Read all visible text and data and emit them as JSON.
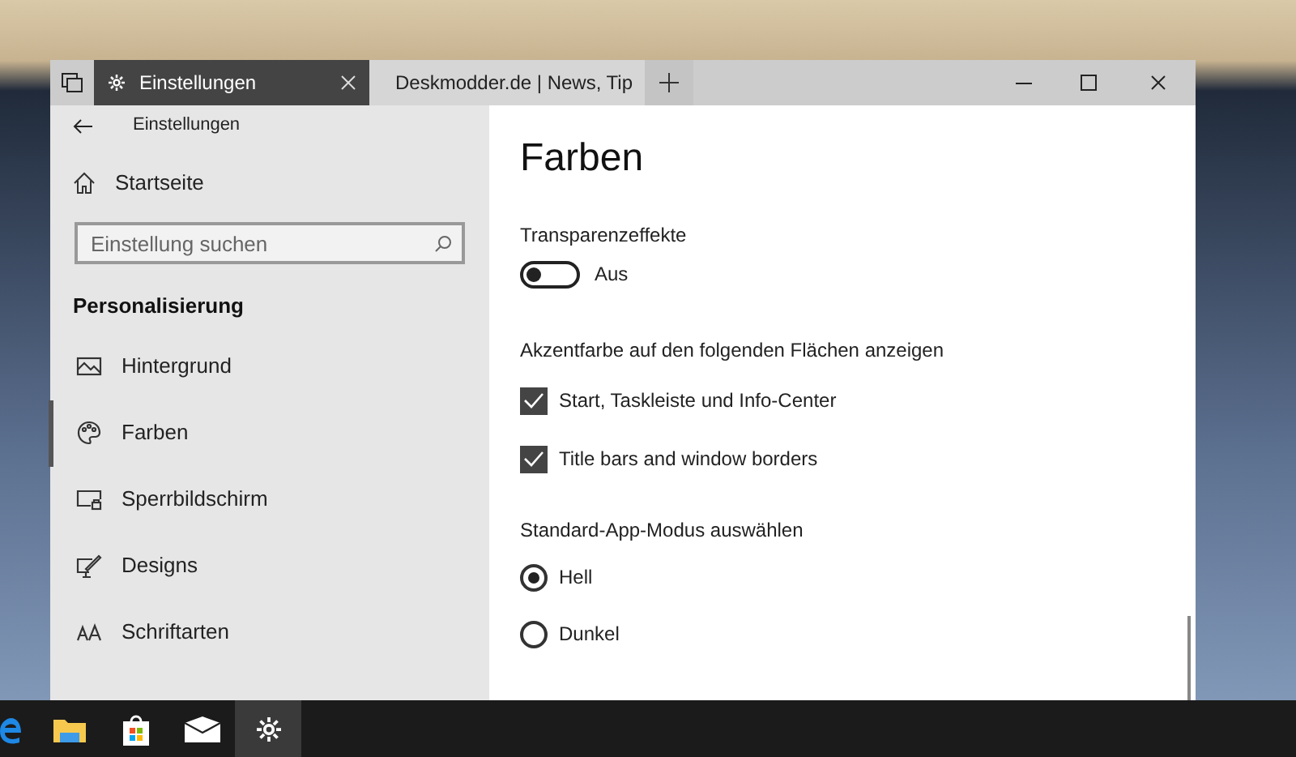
{
  "browser_tabs": [
    {
      "kind": "settings",
      "label": "Einstellungen",
      "selected": true
    },
    {
      "kind": "page",
      "label": "Deskmodder.de | News, Tip",
      "selected": false
    }
  ],
  "app_header": {
    "title": "Einstellungen"
  },
  "sidebar": {
    "home": "Startseite",
    "search": {
      "placeholder": "Einstellung suchen"
    },
    "section": "Personalisierung",
    "items": [
      {
        "kind": "background",
        "label": "Hintergrund",
        "selected": false
      },
      {
        "kind": "colors",
        "label": "Farben",
        "selected": true
      },
      {
        "kind": "lockscreen",
        "label": "Sperrbildschirm",
        "selected": false
      },
      {
        "kind": "themes",
        "label": "Designs",
        "selected": false
      },
      {
        "kind": "fonts",
        "label": "Schriftarten",
        "selected": false
      }
    ]
  },
  "content": {
    "title": "Farben",
    "transparency": {
      "label": "Transparenzeffekte",
      "on": false,
      "state_text": "Aus"
    },
    "accent": {
      "label": "Akzentfarbe auf den folgenden Flächen anzeigen",
      "options": [
        {
          "label": "Start, Taskleiste und Info-Center",
          "checked": true
        },
        {
          "label": "Title bars and window borders",
          "checked": true
        }
      ]
    },
    "app_mode": {
      "label": "Standard-App-Modus auswählen",
      "options": [
        {
          "label": "Hell",
          "selected": true
        },
        {
          "label": "Dunkel",
          "selected": false
        }
      ]
    }
  },
  "taskbar": [
    {
      "kind": "edge",
      "selected": false
    },
    {
      "kind": "explorer",
      "selected": false
    },
    {
      "kind": "store",
      "selected": false
    },
    {
      "kind": "mail",
      "selected": false
    },
    {
      "kind": "settings",
      "selected": true
    }
  ]
}
